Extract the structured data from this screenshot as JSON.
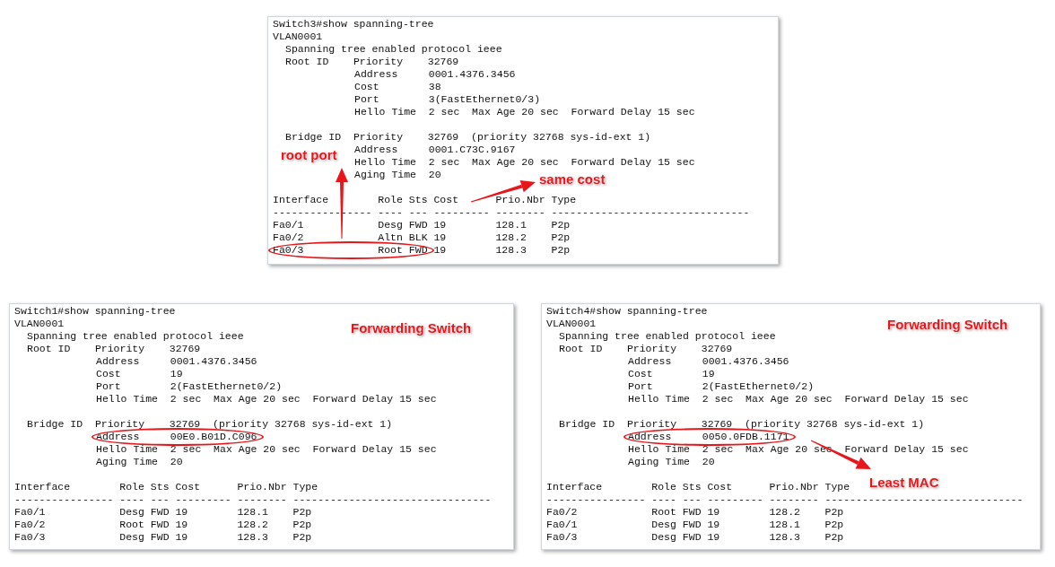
{
  "panels": [
    {
      "lines": [
        {
          "text": "Switch3#show spanning-tree"
        },
        {
          "text": "VLAN0001"
        },
        {
          "text": "  Spanning tree enabled protocol ieee"
        },
        {
          "text": "  Root ID    Priority    32769"
        },
        {
          "text": "             Address     0001.4376.3456"
        },
        {
          "text": "             Cost        38"
        },
        {
          "text": "             Port        3(FastEthernet0/3)"
        },
        {
          "text": "             Hello Time  2 sec  Max Age 20 sec  Forward Delay 15 sec"
        },
        {
          "text": "  Bridge ID  Priority    32769  (priority 32768 sys-id-ext 1)",
          "gap_before": true
        },
        {
          "text": "             Address     0001.C73C.9167"
        },
        {
          "text": "             Hello Time  2 sec  Max Age 20 sec  Forward Delay 15 sec"
        },
        {
          "text": "             Aging Time  20"
        },
        {
          "text": "Interface        Role Sts Cost      Prio.Nbr Type",
          "gap_before": true
        },
        {
          "text": "---------------- ---- --- --------- -------- --------------------------------"
        },
        {
          "text": "Fa0/1            Desg FWD 19        128.1    P2p"
        },
        {
          "text": "Fa0/2            Altn BLK 19        128.2    P2p"
        },
        {
          "text": "Fa0/3            Root FWD 19        128.3    P2p",
          "highlighted": true
        }
      ],
      "callouts": [
        {
          "text": "root port"
        },
        {
          "text": "same cost"
        }
      ]
    },
    {
      "lines": [
        {
          "text": "Switch1#show spanning-tree"
        },
        {
          "text": "VLAN0001"
        },
        {
          "text": "  Spanning tree enabled protocol ieee"
        },
        {
          "text": "  Root ID    Priority    32769"
        },
        {
          "text": "             Address     0001.4376.3456"
        },
        {
          "text": "             Cost        19"
        },
        {
          "text": "             Port        2(FastEthernet0/2)"
        },
        {
          "text": "             Hello Time  2 sec  Max Age 20 sec  Forward Delay 15 sec"
        },
        {
          "text": "  Bridge ID  Priority    32769  (priority 32768 sys-id-ext 1)",
          "gap_before": true
        },
        {
          "text": "             Address     00E0.B01D.C096",
          "highlighted": true
        },
        {
          "text": "             Hello Time  2 sec  Max Age 20 sec  Forward Delay 15 sec"
        },
        {
          "text": "             Aging Time  20"
        },
        {
          "text": "Interface        Role Sts Cost      Prio.Nbr Type",
          "gap_before": true
        },
        {
          "text": "---------------- ---- --- --------- -------- --------------------------------"
        },
        {
          "text": "Fa0/1            Desg FWD 19        128.1    P2p"
        },
        {
          "text": "Fa0/2            Root FWD 19        128.2    P2p"
        },
        {
          "text": "Fa0/3            Desg FWD 19        128.3    P2p"
        }
      ],
      "callouts": [
        {
          "text": "Forwarding Switch"
        }
      ]
    },
    {
      "lines": [
        {
          "text": "Switch4#show spanning-tree"
        },
        {
          "text": "VLAN0001"
        },
        {
          "text": "  Spanning tree enabled protocol ieee"
        },
        {
          "text": "  Root ID    Priority    32769"
        },
        {
          "text": "             Address     0001.4376.3456"
        },
        {
          "text": "             Cost        19"
        },
        {
          "text": "             Port        2(FastEthernet0/2)"
        },
        {
          "text": "             Hello Time  2 sec  Max Age 20 sec  Forward Delay 15 sec"
        },
        {
          "text": "  Bridge ID  Priority    32769  (priority 32768 sys-id-ext 1)",
          "gap_before": true
        },
        {
          "text": "             Address     0050.0FDB.1171",
          "highlighted": true
        },
        {
          "text": "             Hello Time  2 sec  Max Age 20 sec  Forward Delay 15 sec"
        },
        {
          "text": "             Aging Time  20"
        },
        {
          "text": "Interface        Role Sts Cost      Prio.Nbr Type",
          "gap_before": true
        },
        {
          "text": "---------------- ---- --- --------- -------- --------------------------------"
        },
        {
          "text": "Fa0/2            Root FWD 19        128.2    P2p"
        },
        {
          "text": "Fa0/1            Desg FWD 19        128.1    P2p"
        },
        {
          "text": "Fa0/3            Desg FWD 19        128.3    P2p"
        }
      ],
      "callouts": [
        {
          "text": "Forwarding Switch"
        },
        {
          "text": "Least MAC"
        }
      ]
    }
  ]
}
